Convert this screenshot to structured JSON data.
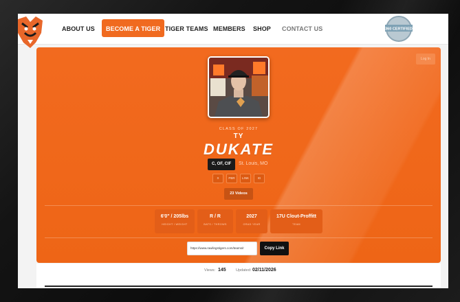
{
  "nav": {
    "items": [
      {
        "label": "ABOUT US"
      },
      {
        "label": "BECOME A TIGER"
      },
      {
        "label": "TIGER TEAMS"
      },
      {
        "label": "MEMBERS"
      },
      {
        "label": "SHOP"
      },
      {
        "label": "CONTACT US"
      }
    ],
    "cert_badge": "360 CERTIFIED",
    "accent": "#f06a1f"
  },
  "hero": {
    "login_label": "Log In",
    "class_of": "CLASS OF 2027",
    "first_name": "TY",
    "last_name": "DUKATE",
    "positions": "C, OF, CIF",
    "location": "St. Louis, MO",
    "social": [
      "X",
      "PBR",
      "LINK",
      "IG"
    ],
    "videos_label": "23 Videos",
    "stats": [
      {
        "value": "6'0\" / 205lbs",
        "label": "HEIGHT / WEIGHT"
      },
      {
        "value": "R / R",
        "label": "BATS / THROWS"
      },
      {
        "value": "2027",
        "label": "GRAD YEAR"
      },
      {
        "value": "17U Clout-Proffitt",
        "label": "TEAM"
      }
    ],
    "share_url": "https://www.rawlingstigers.com/teams/r",
    "copy_label": "Copy Link",
    "background": "#f26a1f"
  },
  "meta": {
    "views_label": "Views:",
    "views_value": "145",
    "updated_label": "Updated:",
    "updated_value": "02/11/2026"
  }
}
